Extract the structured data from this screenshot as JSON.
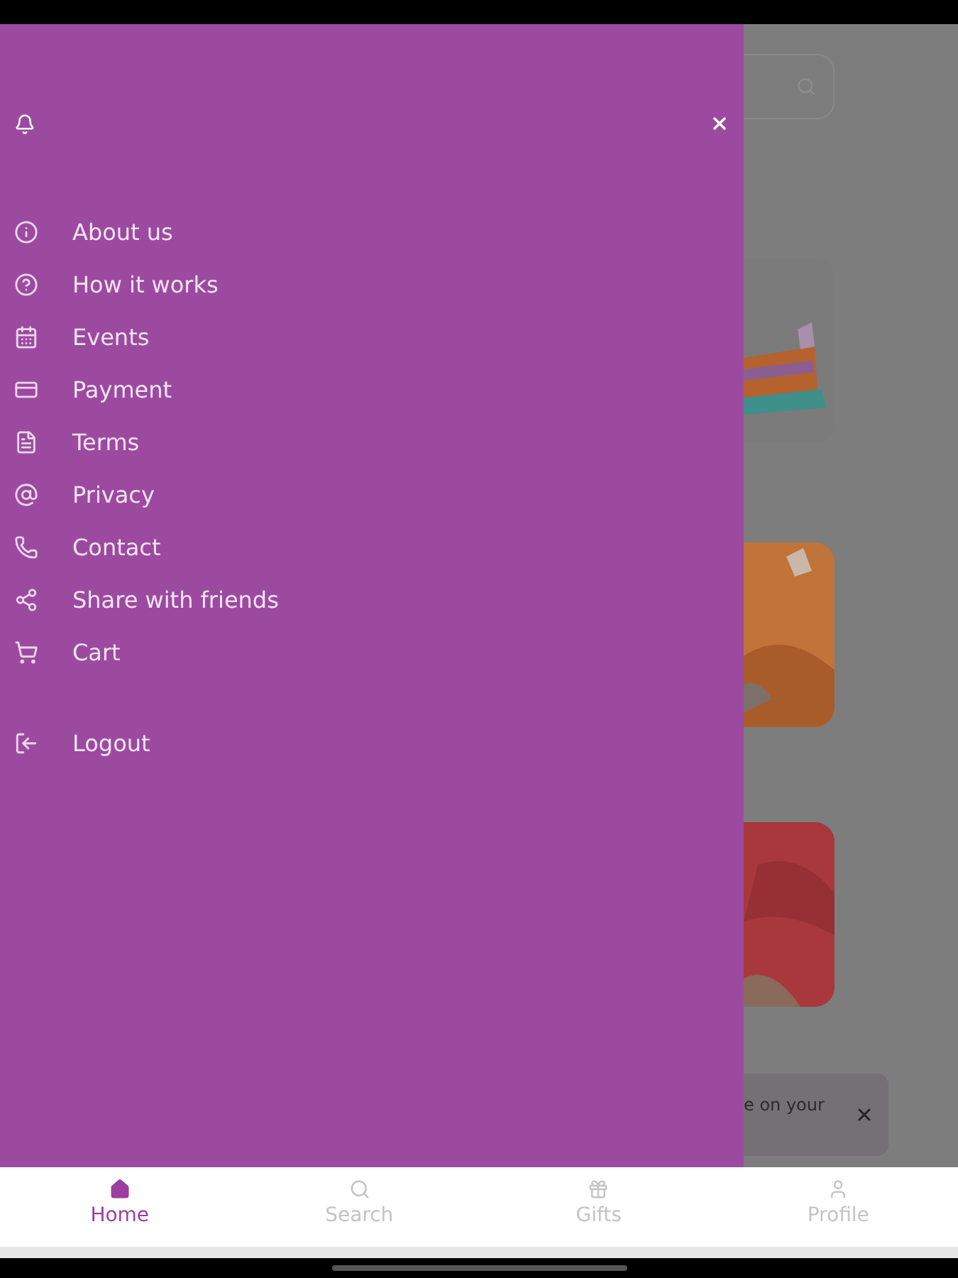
{
  "drawer": {
    "items": [
      {
        "label": "About us"
      },
      {
        "label": "How it works"
      },
      {
        "label": "Events"
      },
      {
        "label": "Payment"
      },
      {
        "label": "Terms"
      },
      {
        "label": "Privacy"
      },
      {
        "label": "Contact"
      },
      {
        "label": "Share with friends"
      },
      {
        "label": "Cart"
      }
    ],
    "logout": {
      "label": "Logout"
    }
  },
  "background": {
    "toast": {
      "text": "e on your"
    }
  },
  "tabs": [
    {
      "label": "Home",
      "selected": true
    },
    {
      "label": "Search",
      "selected": false
    },
    {
      "label": "Gifts",
      "selected": false
    },
    {
      "label": "Profile",
      "selected": false
    }
  ]
}
